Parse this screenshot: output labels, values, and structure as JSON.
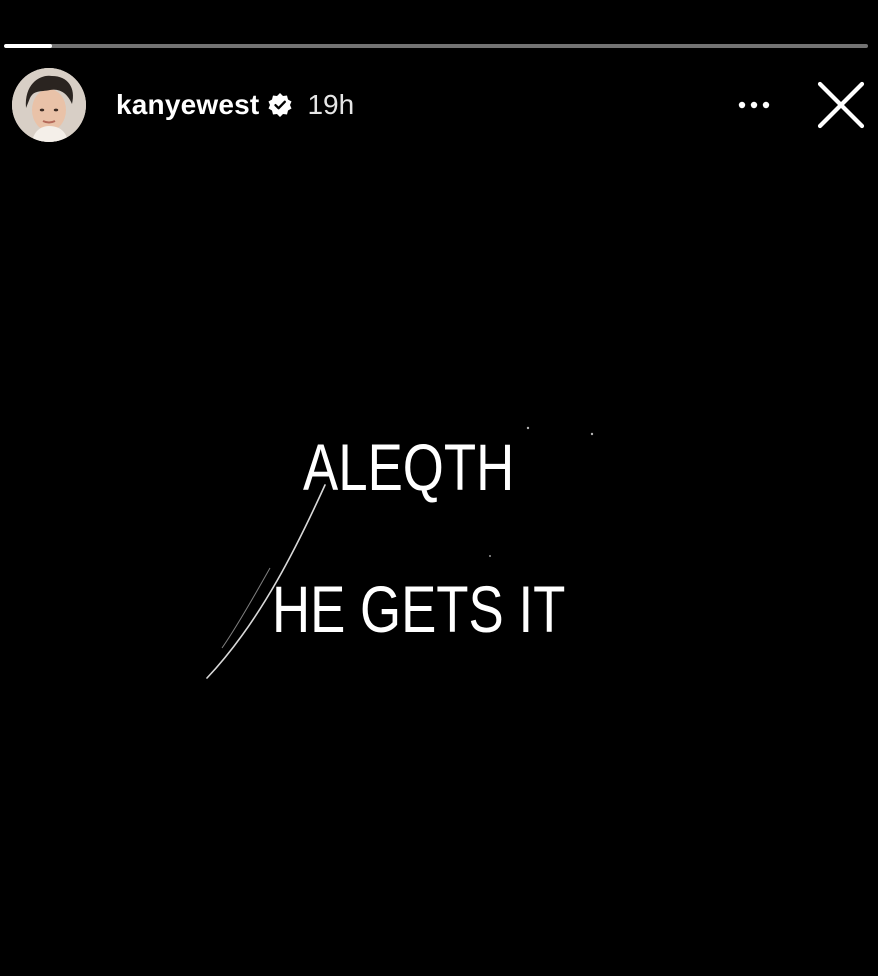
{
  "story": {
    "progress_fraction": 0.055,
    "account": {
      "username": "kanyewest",
      "verified": true,
      "posted_ago": "19h",
      "avatar_icon": "profile-photo"
    },
    "header_actions": {
      "more_icon": "more-dots-icon",
      "close_icon": "close-x-icon"
    },
    "text_lines": [
      "ALEQTH",
      "HE GETS IT"
    ],
    "colors": {
      "background": "#000000",
      "text": "#ffffff",
      "progress_track": "#8a8a8a",
      "progress_fill": "#ffffff"
    }
  }
}
